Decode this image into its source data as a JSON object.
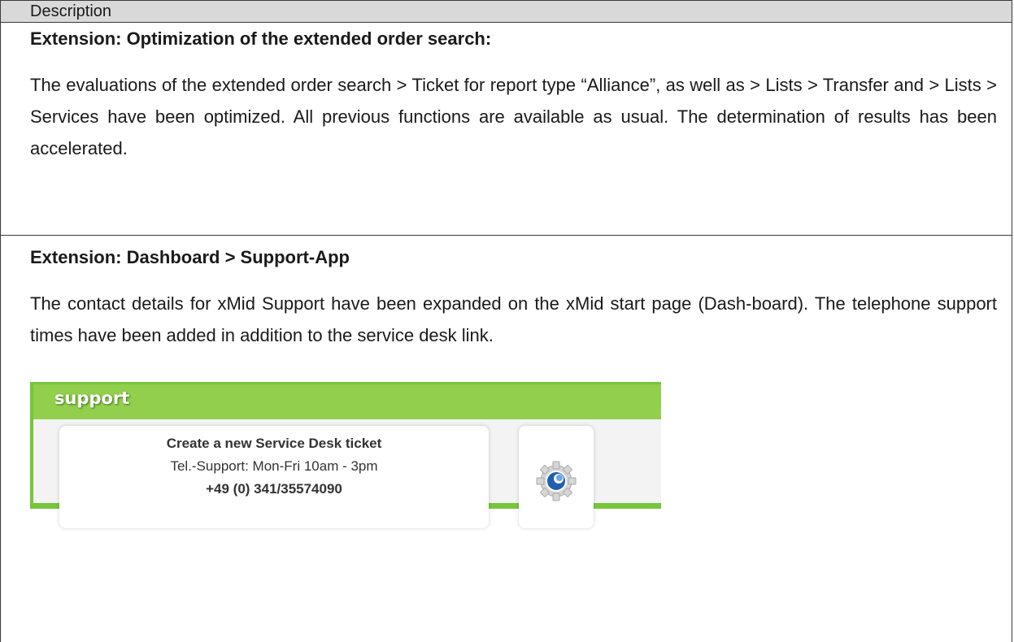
{
  "table": {
    "header": "Description"
  },
  "sections": [
    {
      "title": "Extension: Optimization of the extended order search:",
      "body": "The evaluations of the extended order search > Ticket for report type “Alliance”, as well as > Lists > Transfer and > Lists > Services have been optimized. All previous functions are available as usual. The determination of results has been accelerated."
    },
    {
      "title": "Extension: Dashboard > Support-App",
      "body": "The contact details for xMid Support have been expanded on the xMid start page (Dash-board). The telephone support times have been added in addition to the service desk link."
    }
  ],
  "support_widget": {
    "title": "support",
    "service_desk_link": "Create a new Service Desk ticket",
    "support_times": "Tel.-Support: Mon-Fri 10am - 3pm",
    "phone": "+49 (0) 341/35574090",
    "app_icon": "gear-icon",
    "colors": {
      "frame": "#77c63a",
      "header": "#92cf4d",
      "icon_accent": "#1f5fb0"
    }
  }
}
